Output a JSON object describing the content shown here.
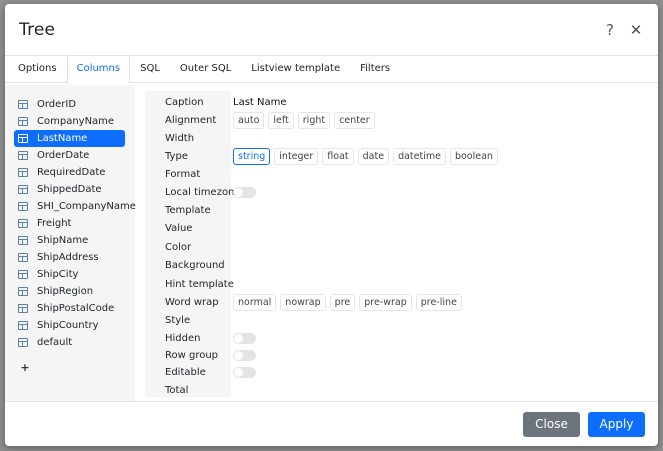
{
  "dialog": {
    "title": "Tree",
    "help_icon": "question-mark-icon",
    "close_icon": "close-icon"
  },
  "tabs": [
    {
      "label": "Options"
    },
    {
      "label": "Columns",
      "active": true
    },
    {
      "label": "SQL"
    },
    {
      "label": "Outer SQL"
    },
    {
      "label": "Listview template"
    },
    {
      "label": "Filters"
    }
  ],
  "columns": [
    "OrderID",
    "CompanyName",
    "LastName",
    "OrderDate",
    "RequiredDate",
    "ShippedDate",
    "SHI_CompanyName",
    "Freight",
    "ShipName",
    "ShipAddress",
    "ShipCity",
    "ShipRegion",
    "ShipPostalCode",
    "ShipCountry",
    "default"
  ],
  "selected_column": "LastName",
  "add_label": "+",
  "properties": {
    "caption": {
      "label": "Caption",
      "value": "Last Name"
    },
    "alignment": {
      "label": "Alignment",
      "options": [
        "auto",
        "left",
        "right",
        "center"
      ]
    },
    "width": {
      "label": "Width"
    },
    "type": {
      "label": "Type",
      "options": [
        "string",
        "integer",
        "float",
        "date",
        "datetime",
        "boolean"
      ],
      "selected": "string"
    },
    "format": {
      "label": "Format"
    },
    "local_timezone": {
      "label": "Local timezone",
      "checked": false
    },
    "template": {
      "label": "Template"
    },
    "value": {
      "label": "Value"
    },
    "color": {
      "label": "Color"
    },
    "background": {
      "label": "Background"
    },
    "hint_template": {
      "label": "Hint template"
    },
    "word_wrap": {
      "label": "Word wrap",
      "options": [
        "normal",
        "nowrap",
        "pre",
        "pre-wrap",
        "pre-line"
      ]
    },
    "style": {
      "label": "Style"
    },
    "hidden": {
      "label": "Hidden",
      "checked": false
    },
    "row_group": {
      "label": "Row group",
      "checked": false
    },
    "editable": {
      "label": "Editable",
      "checked": false
    },
    "total": {
      "label": "Total"
    }
  },
  "footer": {
    "close_label": "Close",
    "apply_label": "Apply"
  },
  "colors": {
    "accent": "#0d6efd",
    "secondary": "#6c757d"
  }
}
